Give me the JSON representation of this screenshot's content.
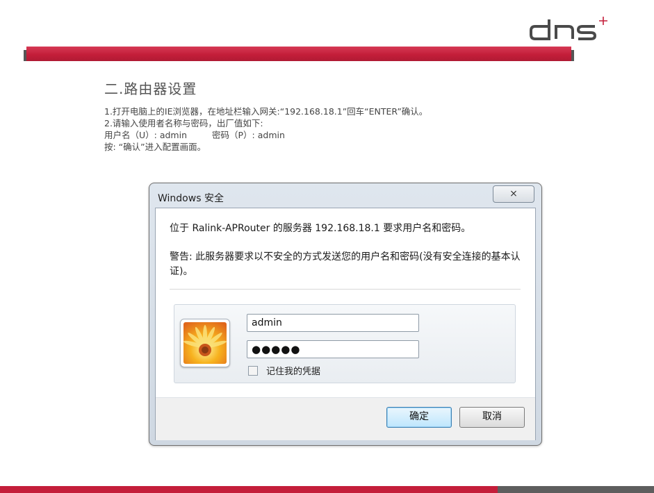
{
  "slide": {
    "logo_text": "dns",
    "section_title": "二.路由器设置",
    "lines": {
      "line1": "1.打开电脑上的IE浏览器，在地址栏输入网关:“192.168.18.1”回车“ENTER”确认。",
      "line2": "2.请输入使用者名称与密码，出厂值如下:",
      "line3_user": "用户名（U）: admin",
      "line3_pass": "密码（P）: admin",
      "line4": "按: “确认”进入配置画面。"
    },
    "colors": {
      "accent_red": "#c41e3a",
      "dark_grey": "#5e5e5e"
    }
  },
  "dialog": {
    "title": "Windows 安全",
    "close_symbol": "⨯",
    "message": "位于 Ralink-APRouter 的服务器 192.168.18.1 要求用户名和密码。",
    "warning": "警告: 此服务器要求以不安全的方式发送您的用户名和密码(没有安全连接的基本认证)。",
    "username_value": "admin",
    "password_value": "●●●●●",
    "remember_label": "记住我的凭据",
    "ok_label": "确定",
    "cancel_label": "取消"
  }
}
